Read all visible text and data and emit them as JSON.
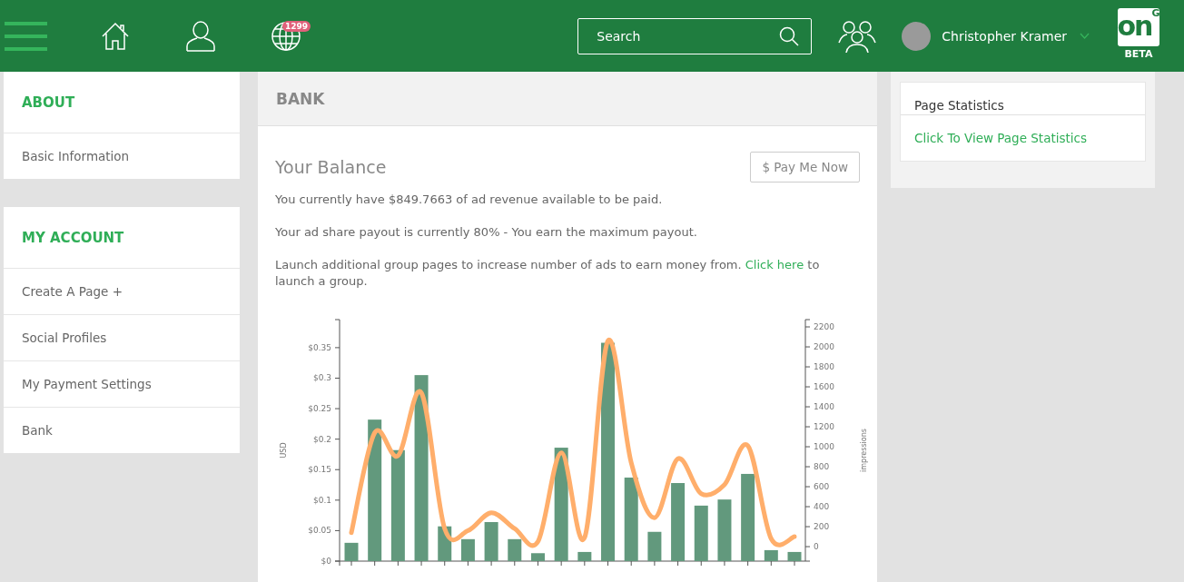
{
  "header": {
    "notification_badge": "1299",
    "search": {
      "placeholder": "Search"
    },
    "user": {
      "name": "Christopher Kramer"
    },
    "logo": {
      "mark": "on",
      "superscript": "G",
      "label": "BETA"
    }
  },
  "sidebar": [
    {
      "title": "ABOUT",
      "items": [
        {
          "label": "Basic Information"
        }
      ]
    },
    {
      "title": "MY ACCOUNT",
      "items": [
        {
          "label": "Create A Page +"
        },
        {
          "label": "Social Profiles"
        },
        {
          "label": "My Payment Settings"
        },
        {
          "label": "Bank"
        }
      ]
    }
  ],
  "main": {
    "title": "BANK",
    "balance_title": "Your Balance",
    "pay_button": "$ Pay Me Now",
    "paragraphs": [
      {
        "before": "You currently have $849.7663 of ad revenue available to be paid."
      },
      {
        "before": "Your ad share payout is currently 80% - You earn the maximum payout."
      },
      {
        "before": "Launch additional group pages to increase number of ads to earn money from. ",
        "link": "Click here",
        "after": " to launch a group."
      }
    ],
    "chart_data": {
      "type": "bar",
      "ylabel": "USD",
      "y2label": "impressions",
      "series": [
        {
          "axis": "y",
          "color": "#62997d",
          "values": [
            0.03,
            0.232,
            0.182,
            0.305,
            0.057,
            0.036,
            0.064,
            0.036,
            0.013,
            0.186,
            0.015,
            0.358,
            0.137,
            0.048,
            0.128,
            0.091,
            0.101,
            0.143,
            0.018,
            0.015
          ]
        },
        {
          "type": "line",
          "axis": "y2",
          "color": "#ffae6b",
          "values": [
            140,
            1140,
            910,
            1540,
            180,
            160,
            340,
            180,
            50,
            940,
            90,
            2060,
            840,
            290,
            880,
            530,
            620,
            1010,
            80,
            100
          ]
        }
      ],
      "ylim": [
        0,
        0.396
      ],
      "y2lim": [
        -145,
        2273
      ],
      "yticks": [
        {
          "value": 0,
          "label": "$0"
        },
        {
          "value": 0.05,
          "label": "$0.05"
        },
        {
          "value": 0.1,
          "label": "$0.1"
        },
        {
          "value": 0.15,
          "label": "$0.15"
        },
        {
          "value": 0.2,
          "label": "$0.2"
        },
        {
          "value": 0.25,
          "label": "$0.25"
        },
        {
          "value": 0.3,
          "label": "$0.3"
        },
        {
          "value": 0.35,
          "label": "$0.35"
        }
      ],
      "y2ticks": [
        0,
        200,
        400,
        600,
        800,
        1000,
        1200,
        1400,
        1600,
        1800,
        2000,
        2200
      ]
    }
  },
  "right_panel": {
    "title": "Page Statistics",
    "link": "Click To View Page Statistics"
  }
}
